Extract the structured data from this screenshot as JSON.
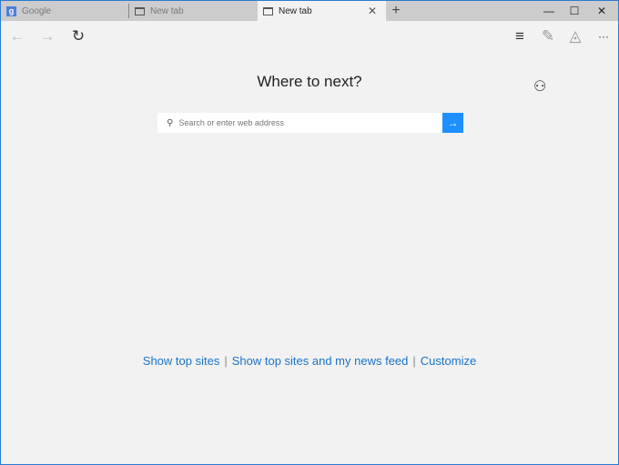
{
  "tabs": [
    {
      "label": "Google",
      "icon": "google-favicon",
      "favicon_text": "g"
    },
    {
      "label": "New tab",
      "icon": "page-icon"
    },
    {
      "label": "New tab",
      "icon": "page-icon",
      "active": true
    }
  ],
  "tab_close": "✕",
  "new_tab": "+",
  "window_controls": {
    "minimize": "—",
    "maximize": "☐",
    "close": "✕"
  },
  "toolbar": {
    "back": "←",
    "forward": "→",
    "refresh": "↻",
    "hub": "≡",
    "note": "✎",
    "share": "◬",
    "more": "···"
  },
  "main": {
    "title": "Where to next?",
    "search_placeholder": "Search or enter web address",
    "go": "→",
    "user_add": "⚇"
  },
  "links": {
    "top_sites": "Show top sites",
    "top_sites_news": "Show top sites and my news feed",
    "customize": "Customize",
    "separator": "|"
  },
  "colors": {
    "accent": "#1e90ff",
    "link": "#1a73c9"
  }
}
